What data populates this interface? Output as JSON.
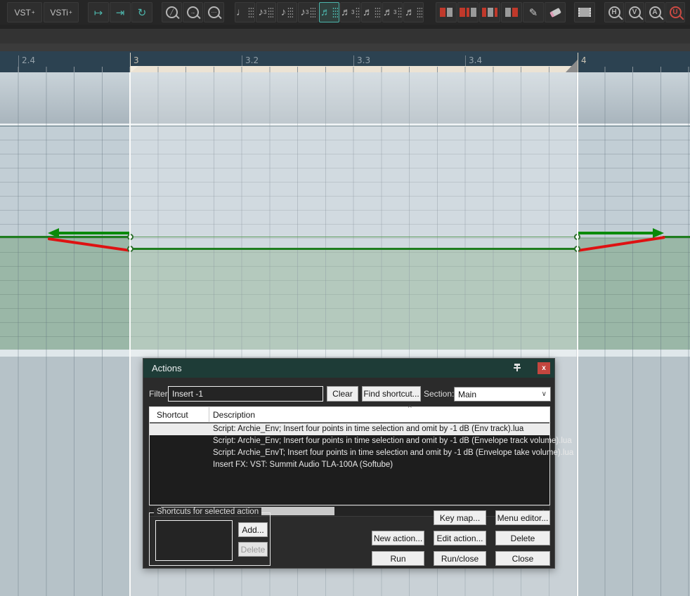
{
  "toolbar": {
    "vst_label": "VST",
    "vst_sup": "+",
    "vsti_label": "VSTi",
    "vsti_sup": "+",
    "icons": {
      "marker_out": "↦",
      "marker_in": "⇥",
      "cycle": "↻",
      "circle_slash": "╱",
      "circle_arrow": "→",
      "circle_dots": "⋯",
      "pencil": "✎"
    },
    "note_buttons": [
      {
        "glyph": "♩",
        "triplet": ""
      },
      {
        "glyph": "♪",
        "triplet": "3"
      },
      {
        "glyph": "♪",
        "triplet": ""
      },
      {
        "glyph": "♪",
        "triplet": "3"
      },
      {
        "glyph": "♬",
        "triplet": ""
      },
      {
        "glyph": "♬",
        "triplet": "3"
      },
      {
        "glyph": "♬",
        "triplet": ""
      },
      {
        "glyph": "♬",
        "triplet": "3"
      },
      {
        "glyph": "♬",
        "triplet": ""
      }
    ],
    "zoom_buttons": [
      "H",
      "V",
      "A",
      "U"
    ],
    "accent_color": "#4db6ac",
    "alert_color": "#c0392b"
  },
  "ruler": {
    "labels": [
      "2.4",
      "3",
      "3.2",
      "3.3",
      "3.4",
      "4"
    ],
    "selection_start": "3",
    "selection_end": "4"
  },
  "envelope": {
    "type": "volume",
    "line_color": "#1f7d1f",
    "ramp_color": "#de1212",
    "arrow_color": "#0a8a0a",
    "edit": "-1 dB inside time selection"
  },
  "actions_dialog": {
    "title": "Actions",
    "close_glyph": "x",
    "filter_label": "Filter:",
    "filter_value": "Insert -1",
    "clear_label": "Clear",
    "find_shortcut_label": "Find shortcut...",
    "section_label": "Section:",
    "section_value": "Main",
    "sort_glyph": "^",
    "columns": {
      "shortcut": "Shortcut",
      "description": "Description"
    },
    "rows": [
      {
        "description": "Script: Archie_Env; Insert four points in time selection and omit by -1 dB (Env track).lua"
      },
      {
        "description": "Script: Archie_Env; Insert four points in time selection and omit by -1 dB (Envelope track volume).lua"
      },
      {
        "description": "Script: Archie_EnvT; Insert four points in time selection and omit by -1 dB (Envelope take volume).lua"
      },
      {
        "description": "Insert FX: VST: Summit Audio TLA-100A (Softube)"
      }
    ],
    "scroll": {
      "left_glyph": "‹",
      "right_glyph": "›"
    },
    "group_label": "Shortcuts for selected action",
    "buttons": {
      "add": "Add...",
      "delete_shortcut": "Delete",
      "key_map": "Key map...",
      "menu_editor": "Menu editor...",
      "new_action": "New action...",
      "edit_action": "Edit action...",
      "delete": "Delete",
      "run": "Run",
      "run_close": "Run/close",
      "close": "Close"
    }
  }
}
